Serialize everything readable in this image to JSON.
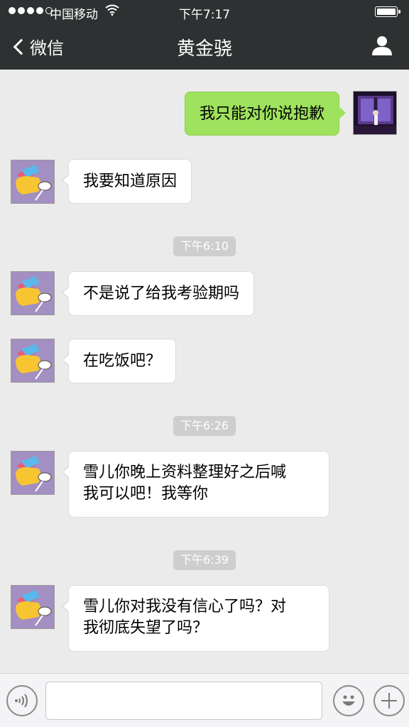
{
  "status_bar": {
    "carrier": "中国移动",
    "time": "下午7:17",
    "signal_icon": "signal-dots-icon",
    "wifi_icon": "wifi-icon",
    "battery_icon": "battery-icon",
    "battery_level": 1.0
  },
  "nav": {
    "back_label": "微信",
    "title": "黄金骁",
    "back_icon": "chevron-left-icon",
    "profile_icon": "person-icon"
  },
  "messages": [
    {
      "sender": "me",
      "text": "我只能对你说抱歉"
    },
    {
      "sender": "contact",
      "text": "我要知道原因"
    },
    {
      "timestamp": "下午6:10"
    },
    {
      "sender": "contact",
      "text": "不是说了给我考验期吗"
    },
    {
      "sender": "contact",
      "text": "在吃饭吧？"
    },
    {
      "timestamp": "下午6:26"
    },
    {
      "sender": "contact",
      "text_line1": "雪儿你晚上资料整理好之后喊",
      "text_line2": "我可以吧！我等你"
    },
    {
      "timestamp": "下午6:39"
    },
    {
      "sender": "contact",
      "text_line1": "雪儿你对我没有信心了吗？对",
      "text_line2": "我彻底失望了吗？"
    }
  ],
  "input_bar": {
    "voice_icon": "voice-icon",
    "emoji_icon": "smiley-icon",
    "add_icon": "plus-icon",
    "message_value": ""
  },
  "colors": {
    "header_bg": "#2e3132",
    "chat_bg": "#ebebeb",
    "my_bubble": "#9fe25d",
    "their_bubble": "#ffffff"
  }
}
